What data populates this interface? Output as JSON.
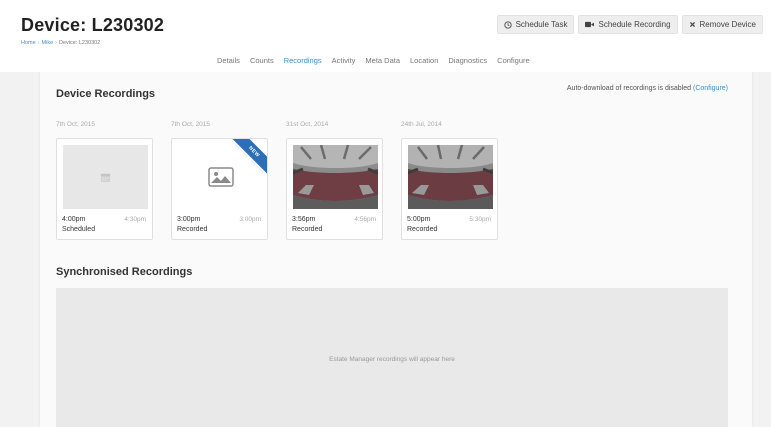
{
  "page": {
    "title": "Device: L230302",
    "breadcrumb": [
      "Home",
      "Mike",
      "Device: L230302"
    ]
  },
  "actions": [
    {
      "label": "Schedule Task",
      "icon": "clock-icon"
    },
    {
      "label": "Schedule Recording",
      "icon": "video-camera-icon"
    },
    {
      "label": "Remove Device",
      "icon": "close-icon"
    }
  ],
  "tabs": [
    {
      "label": "Details",
      "active": false
    },
    {
      "label": "Counts",
      "active": false
    },
    {
      "label": "Recordings",
      "active": true
    },
    {
      "label": "Activity",
      "active": false
    },
    {
      "label": "Meta Data",
      "active": false
    },
    {
      "label": "Location",
      "active": false
    },
    {
      "label": "Diagnostics",
      "active": false
    },
    {
      "label": "Configure",
      "active": false
    }
  ],
  "device_recordings": {
    "title": "Device Recordings",
    "autodownload_text": "Auto-download of recordings is disabled",
    "autodownload_link": "(Configure)",
    "recordings": [
      {
        "date": "7th Oct, 2015",
        "start": "4:00pm",
        "end": "4:30pm",
        "status": "Scheduled",
        "thumb": "calendar-icon",
        "new": false
      },
      {
        "date": "7th Oct, 2015",
        "start": "3:00pm",
        "end": "3:00pm",
        "status": "Recorded",
        "thumb": "image-icon",
        "new": true
      },
      {
        "date": "31st Oct, 2014",
        "start": "3:56pm",
        "end": "4:56pm",
        "status": "Recorded",
        "thumb": "camera-snapshot",
        "new": false
      },
      {
        "date": "24th Jul, 2014",
        "start": "5:00pm",
        "end": "5:30pm",
        "status": "Recorded",
        "thumb": "camera-snapshot",
        "new": false
      }
    ],
    "new_badge": "NEW"
  },
  "synchronised": {
    "title": "Synchronised Recordings",
    "empty_message": "Estate Manager recordings will appear here"
  },
  "colors": {
    "accent": "#3a8fcf",
    "ribbon": "#2c6fb8",
    "floor": "#6e3e44"
  }
}
